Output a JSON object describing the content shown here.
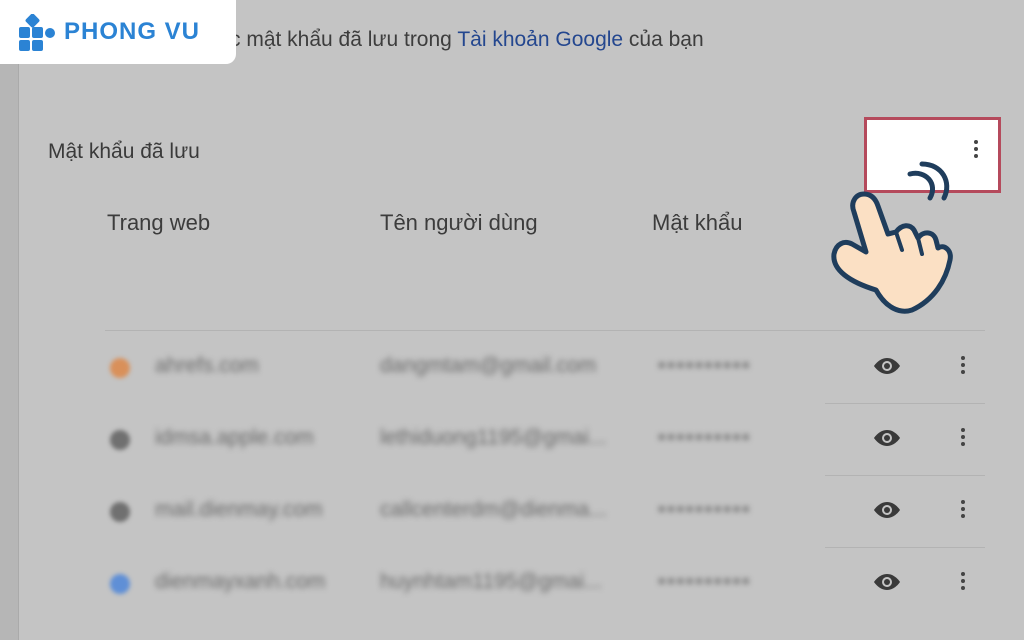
{
  "logo": {
    "text": "PHONG VU"
  },
  "header": {
    "prefix": "c mật khẩu đã lưu trong ",
    "link": "Tài khoản Google",
    "suffix": " của bạn"
  },
  "section": {
    "title": "Mật khẩu đã lưu"
  },
  "columns": {
    "site": "Trang web",
    "user": "Tên người dùng",
    "password": "Mật khẩu"
  },
  "rows": [
    {
      "site": "ahrefs.com",
      "user": "dangmtam@gmail.com",
      "password": "••••••••••",
      "favicon_color": "#d9905a"
    },
    {
      "site": "idmsa.apple.com",
      "user": "lethiduong1195@gmai...",
      "password": "••••••••••",
      "favicon_color": "#707070"
    },
    {
      "site": "mail.dienmay.com",
      "user": "callcenterdm@dienma...",
      "password": "••••••••••",
      "favicon_color": "#707070"
    },
    {
      "site": "dienmayxanh.com",
      "user": "huynhtam1195@gmai...",
      "password": "••••••••••",
      "favicon_color": "#5f8fd6"
    }
  ],
  "icons": {
    "more": "more-vert-icon",
    "eye": "eye-icon",
    "hand": "hand-pointer-icon",
    "logo": "phongvu-logo-icon"
  },
  "colors": {
    "highlight_border": "#b54a5c",
    "link": "#24478f",
    "logo": "#2b83d4"
  }
}
